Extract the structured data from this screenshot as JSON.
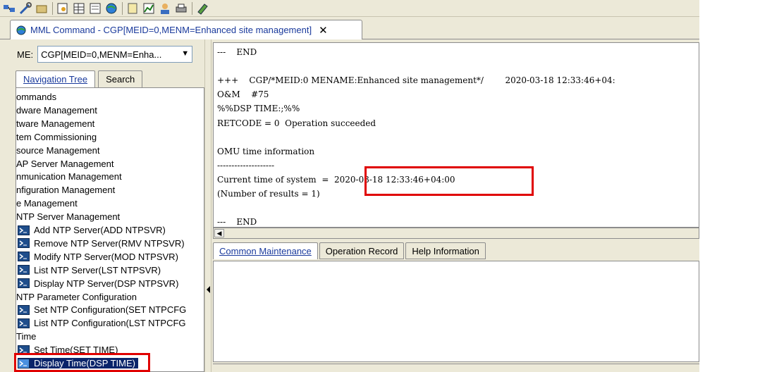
{
  "tab": {
    "title": "MML Command - CGP[MEID=0,MENM=Enhanced site management]",
    "close": "✕"
  },
  "me": {
    "label": "ME:",
    "value": "CGP[MEID=0,MENM=Enha...",
    "arrow": "▼"
  },
  "nav_tabs": [
    "Navigation Tree",
    "Search"
  ],
  "tree": [
    {
      "text": "ommands",
      "cmd": false
    },
    {
      "text": "dware Management",
      "cmd": false
    },
    {
      "text": "tware Management",
      "cmd": false
    },
    {
      "text": "tem Commissioning",
      "cmd": false
    },
    {
      "text": "source Management",
      "cmd": false
    },
    {
      "text": "AP Server Management",
      "cmd": false
    },
    {
      "text": "nmunication Management",
      "cmd": false
    },
    {
      "text": "nfiguration Management",
      "cmd": false
    },
    {
      "text": "e Management",
      "cmd": false
    },
    {
      "text": "NTP Server Management",
      "cmd": false
    },
    {
      "text": "Add NTP Server(ADD NTPSVR)",
      "cmd": true
    },
    {
      "text": "Remove NTP Server(RMV NTPSVR)",
      "cmd": true
    },
    {
      "text": "Modify NTP Server(MOD NTPSVR)",
      "cmd": true
    },
    {
      "text": "List NTP Server(LST NTPSVR)",
      "cmd": true
    },
    {
      "text": "Display NTP Server(DSP NTPSVR)",
      "cmd": true
    },
    {
      "text": "NTP Parameter Configuration",
      "cmd": false
    },
    {
      "text": "Set NTP Configuration(SET NTPCFG",
      "cmd": true
    },
    {
      "text": "List NTP Configuration(LST NTPCFG",
      "cmd": true
    },
    {
      "text": "Time",
      "cmd": false
    },
    {
      "text": "Set Time(SET TIME)",
      "cmd": true
    },
    {
      "text": "Display Time(DSP TIME)",
      "cmd": true,
      "selected": true
    }
  ],
  "console": {
    "lines": [
      "---    END",
      "",
      "+++    CGP/*MEID:0 MENAME:Enhanced site management*/        2020-03-18 12:33:46+04:",
      "O&M    #75",
      "%%DSP TIME:;%%",
      "RETCODE = 0  Operation succeeded",
      "",
      "OMU time information",
      "--------------------",
      "Current time of system  =  2020-03-18 12:33:46+04:00",
      "(Number of results = 1)",
      "",
      "---    END"
    ]
  },
  "bottom_tabs": [
    "Common Maintenance",
    "Operation Record",
    "Help Information"
  ],
  "colors": {
    "highlight": "#e00000",
    "selection": "#0a246a",
    "tab_text": "#1a3a9c"
  }
}
